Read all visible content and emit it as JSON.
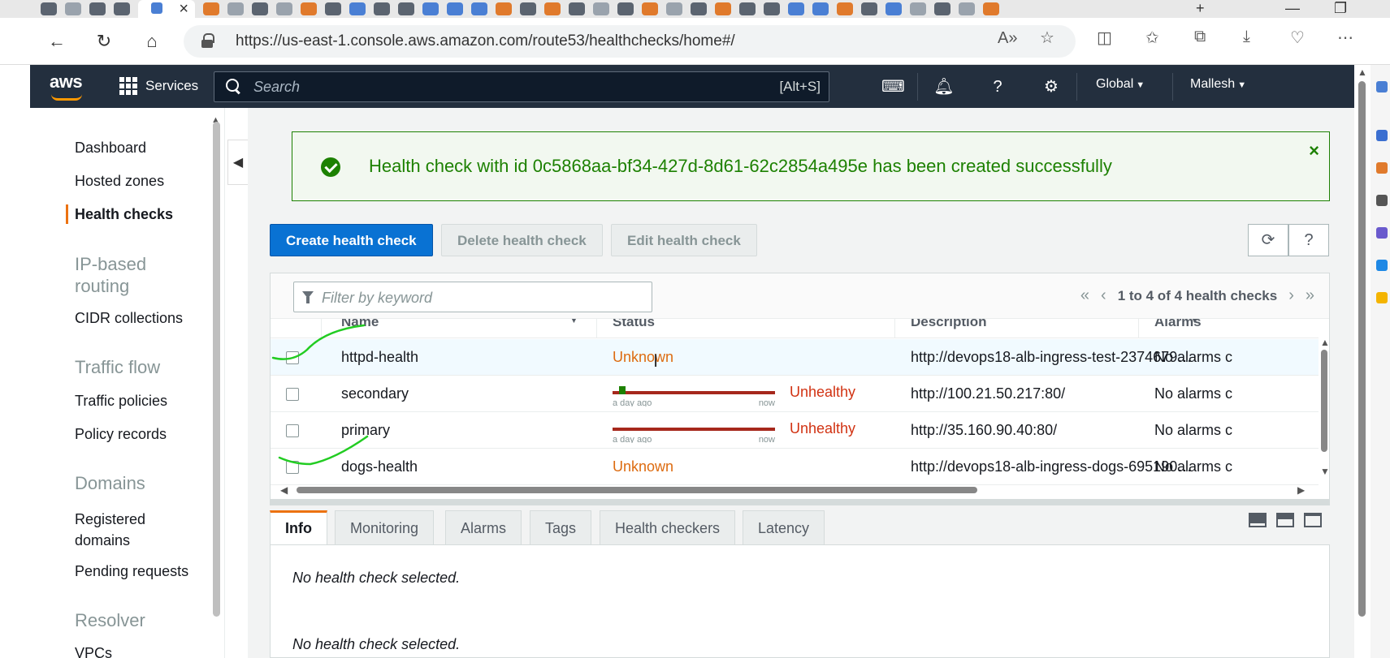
{
  "browser": {
    "url": "https://us-east-1.console.aws.amazon.com/route53/healthchecks/home#/",
    "close_tab": "×",
    "new_tab": "+"
  },
  "header": {
    "logo": "aws",
    "services": "Services",
    "search_placeholder": "Search",
    "search_shortcut": "[Alt+S]",
    "region": "Global",
    "user": "Mallesh"
  },
  "sidebar": {
    "items": [
      {
        "label": "Dashboard"
      },
      {
        "label": "Hosted zones"
      },
      {
        "label": "Health checks",
        "active": true
      }
    ],
    "sections": [
      {
        "title": "IP-based routing",
        "items": [
          "CIDR collections"
        ]
      },
      {
        "title": "Traffic flow",
        "items": [
          "Traffic policies",
          "Policy records"
        ]
      },
      {
        "title": "Domains",
        "items": [
          "Registered domains",
          "Pending requests"
        ]
      },
      {
        "title": "Resolver",
        "items": [
          "VPCs"
        ]
      }
    ]
  },
  "flash": {
    "message": "Health check with id 0c5868aa-bf34-427d-8d61-62c2854a495e has been created successfully",
    "status_color": "#1d8102"
  },
  "toolbar": {
    "create": "Create health check",
    "delete": "Delete health check",
    "edit": "Edit health check"
  },
  "table": {
    "filter_placeholder": "Filter by keyword",
    "pagination": "1 to 4 of 4 health checks",
    "columns": [
      "Name",
      "Status",
      "Description",
      "Alarms"
    ],
    "rows": [
      {
        "name": "httpd-health",
        "status": "Unknown",
        "description": "http://devops18-alb-ingress-test-2374679…",
        "alarms": "No alarms c",
        "highlighted": true
      },
      {
        "name": "secondary",
        "status": "Unhealthy",
        "spark_left": "a day ago",
        "spark_right": "now",
        "description": "http://100.21.50.217:80/",
        "alarms": "No alarms c"
      },
      {
        "name": "primary",
        "status": "Unhealthy",
        "spark_left": "a day ago",
        "spark_right": "now",
        "description": "http://35.160.90.40:80/",
        "alarms": "No alarms c"
      },
      {
        "name": "dogs-health",
        "status": "Unknown",
        "description": "http://devops18-alb-ingress-dogs-695190…",
        "alarms": "No alarms c"
      }
    ]
  },
  "detail": {
    "tabs": [
      "Info",
      "Monitoring",
      "Alarms",
      "Tags",
      "Health checkers",
      "Latency"
    ],
    "active_tab": "Info",
    "empty_message": "No health check selected.",
    "empty_message_2": "No health check selected."
  },
  "colors": {
    "primary_button": "#0972d3",
    "unknown": "#dd6b10",
    "unhealthy": "#d13212",
    "nav_bg": "#232f3e",
    "active_nav_marker": "#ec7211",
    "annotation_ink": "#22cc22"
  }
}
